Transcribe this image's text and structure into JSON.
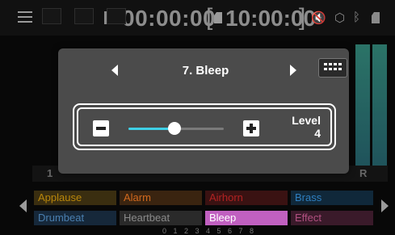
{
  "status_bar": {
    "timecode": "00:00:00",
    "remaining": "10:00:00",
    "bracket_open": "[",
    "bracket_close": "]",
    "icons": [
      "menu-icon",
      "record-stop-icon",
      "sd-card-icon",
      "speaker-mute-icon",
      "usb-icon",
      "bluetooth-icon",
      "card-icon"
    ],
    "mute_color": "#c55a28"
  },
  "channels": {
    "numbers": [
      "1",
      "R"
    ]
  },
  "dialog": {
    "title": "7. Bleep",
    "level_label": "Level",
    "level_value": "4",
    "slider_fraction": 0.48,
    "accent_color": "#3fd0e6"
  },
  "pads": {
    "row1": [
      {
        "label": "Applause",
        "color": "#b8860b",
        "bg": "#3a2e10"
      },
      {
        "label": "Alarm",
        "color": "#d2691e",
        "bg": "#3a2410"
      },
      {
        "label": "Airhorn",
        "color": "#b22222",
        "bg": "#3a1212"
      },
      {
        "label": "Brass",
        "color": "#2f7fc0",
        "bg": "#10283a"
      }
    ],
    "row2": [
      {
        "label": "Drumbeat",
        "color": "#4a7fb0",
        "bg": "#16283a"
      },
      {
        "label": "Heartbeat",
        "color": "#8a8a8a",
        "bg": "#2a2a2a"
      },
      {
        "label": "Bleep",
        "color": "#ffffff",
        "bg": "#c060c0"
      },
      {
        "label": "Effect",
        "color": "#b05080",
        "bg": "#3a1a2a"
      }
    ],
    "page_numbers": "0 1 2 3 4 5 6 7 8"
  }
}
